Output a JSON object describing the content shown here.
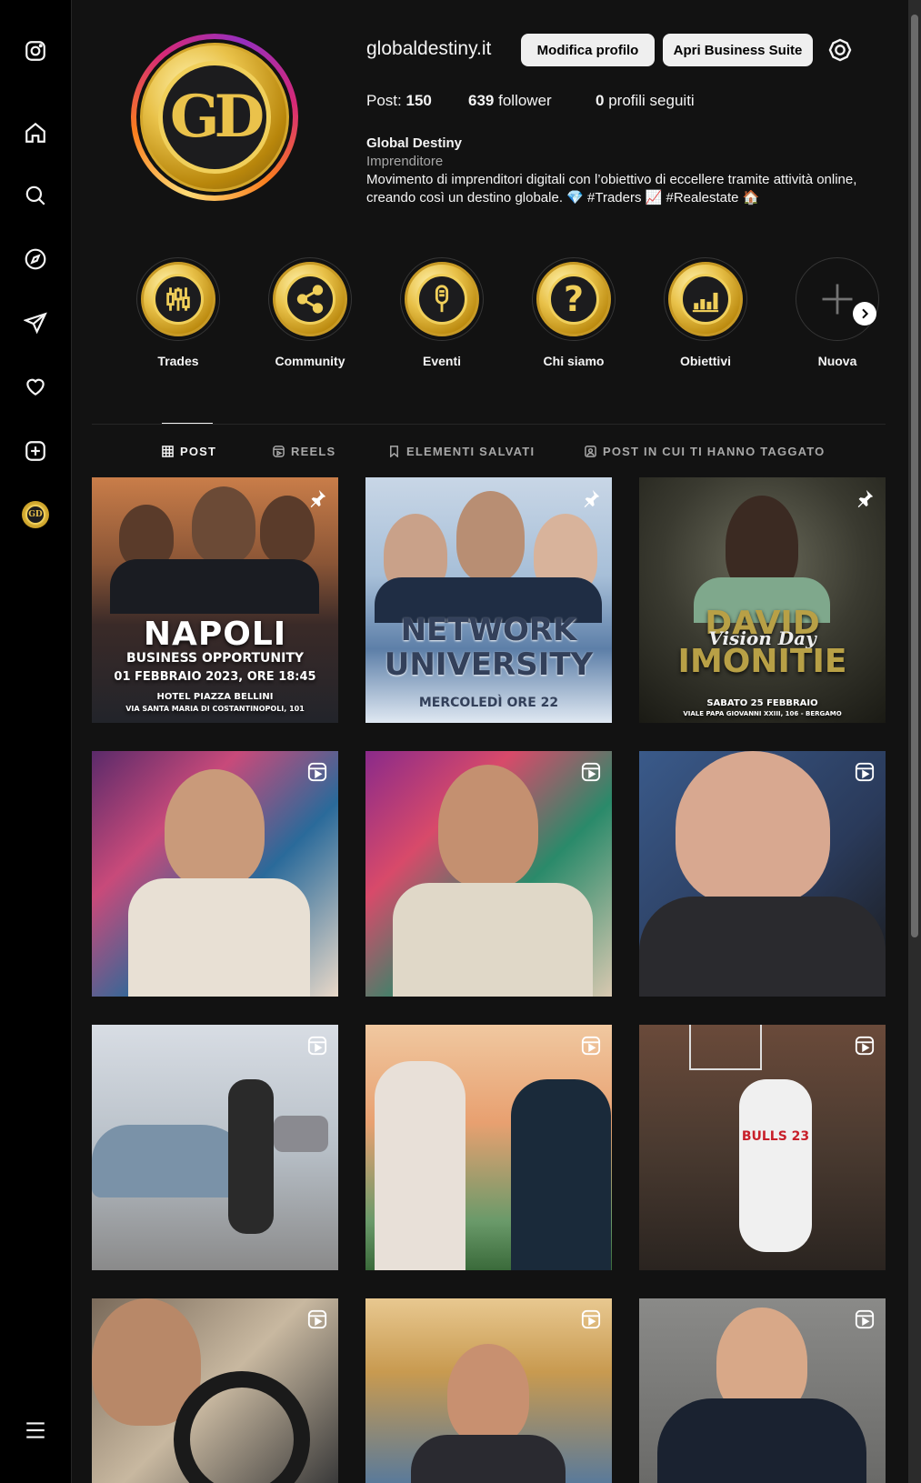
{
  "profile": {
    "username": "globaldestiny.it",
    "edit_button": "Modifica profilo",
    "suite_button": "Apri Business Suite",
    "avatar_text": "GD",
    "stats": {
      "posts_label": "Post:",
      "posts_value": "150",
      "followers_value": "639",
      "followers_label": "follower",
      "following_value": "0",
      "following_label": "profili seguiti"
    },
    "bio": {
      "name": "Global Destiny",
      "category": "Imprenditore",
      "line1": "Movimento di imprenditori digitali con l’obiettivo di eccellere tramite attività online,",
      "line2": "creando così un destino globale. 💎 #Traders 📈 #Realestate 🏠"
    }
  },
  "highlights": [
    {
      "label": "Trades",
      "icon": "candlestick-icon"
    },
    {
      "label": "Community",
      "icon": "share-icon"
    },
    {
      "label": "Eventi",
      "icon": "microphone-icon"
    },
    {
      "label": "Chi siamo",
      "icon": "question-icon"
    },
    {
      "label": "Obiettivi",
      "icon": "growth-chart-icon"
    },
    {
      "label": "Nuova",
      "icon": "plus-icon"
    }
  ],
  "tabs": [
    {
      "label": "POST",
      "icon": "grid-icon",
      "active": true
    },
    {
      "label": "REELS",
      "icon": "reels-icon",
      "active": false
    },
    {
      "label": "ELEMENTI SALVATI",
      "icon": "bookmark-icon",
      "active": false
    },
    {
      "label": "POST IN CUI TI HANNO TAGGATO",
      "icon": "tag-icon",
      "active": false
    }
  ],
  "posts": [
    {
      "type": "pinned",
      "title": "NAPOLI",
      "sub1": "BUSINESS OPPORTUNITY",
      "sub2": "01 FEBBRAIO 2023, ORE 18:45",
      "sub3": "HOTEL PIAZZA BELLINI",
      "sub4": "VIA SANTA MARIA DI COSTANTINOPOLI, 101"
    },
    {
      "type": "pinned",
      "title": "NETWORK",
      "sub1": "UNIVERSITY",
      "sub2": "MERCOLEDÌ ORE 22"
    },
    {
      "type": "pinned",
      "title": "DAVID",
      "sub1": "IMONITIE",
      "script": "Vision Day",
      "sub2": "SABATO 25 FEBBRAIO",
      "sub3": "VIALE PAPA GIOVANNI XXIII, 106 - BERGAMO"
    },
    {
      "type": "reel"
    },
    {
      "type": "reel"
    },
    {
      "type": "reel"
    },
    {
      "type": "reel"
    },
    {
      "type": "reel"
    },
    {
      "type": "reel",
      "jersey": "BULLS 23"
    },
    {
      "type": "reel"
    },
    {
      "type": "reel"
    },
    {
      "type": "reel"
    }
  ],
  "colors": {
    "background": "#121212",
    "sidebar": "#000000",
    "gold": "#e9c24a",
    "button": "#efefef"
  }
}
